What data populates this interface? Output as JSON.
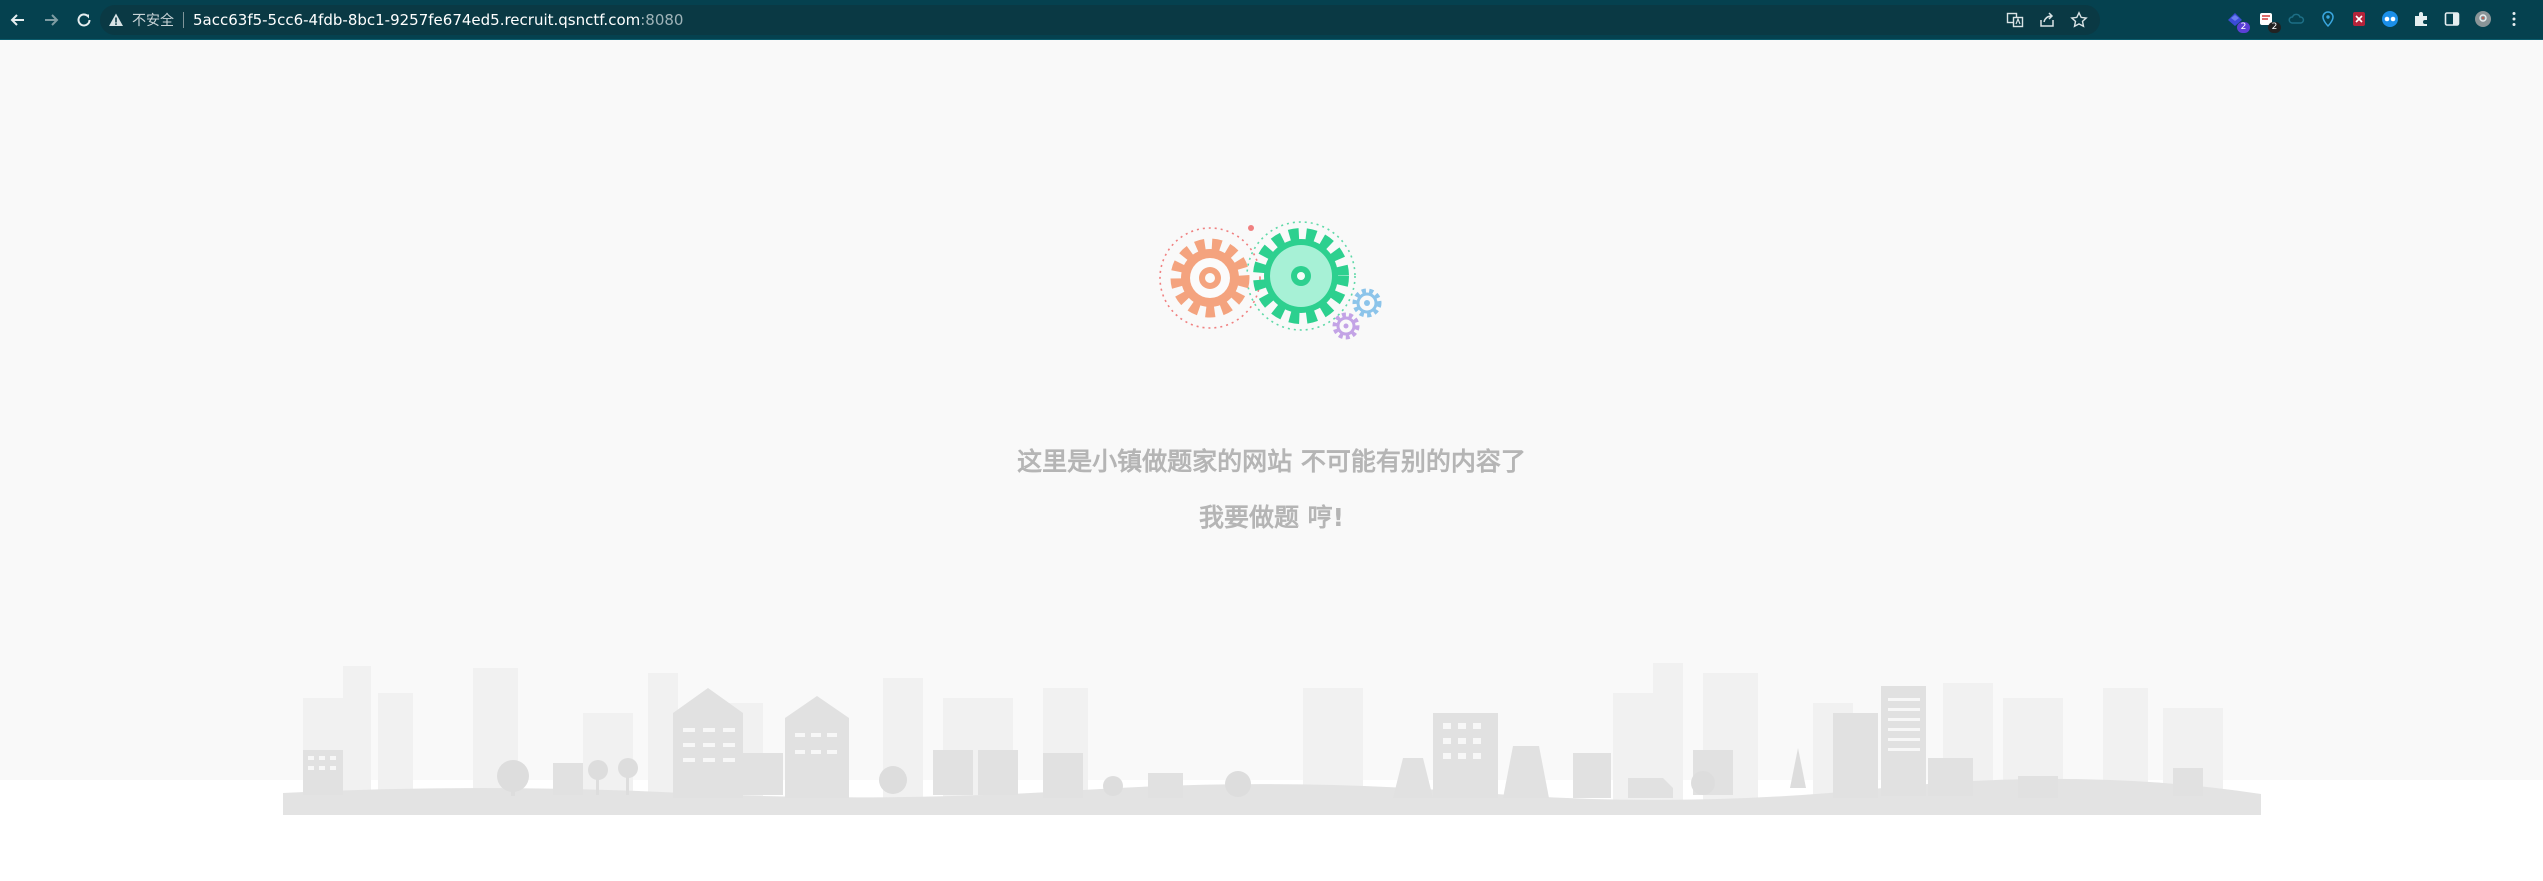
{
  "browser": {
    "security_label": "不安全",
    "url_host": "5acc63f5-5cc6-4fdb-8bc1-9257fe674ed5.recruit.qsnctf.com",
    "url_port": ":8080",
    "extensions": [
      {
        "name": "extension-1",
        "badge": "2"
      },
      {
        "name": "extension-2",
        "badge": "2"
      }
    ],
    "colors": {
      "toolbar": "#05414f",
      "omnibox": "#0a3944"
    }
  },
  "page": {
    "line1": "这里是小镇做题家的网站 不可能有别的内容了",
    "line2": "我要做题 哼!",
    "colors": {
      "background": "#f9f9f9",
      "text": "#b5b5b5",
      "gear_left": "#f4a37e",
      "gear_right": "#2dd08f"
    }
  }
}
